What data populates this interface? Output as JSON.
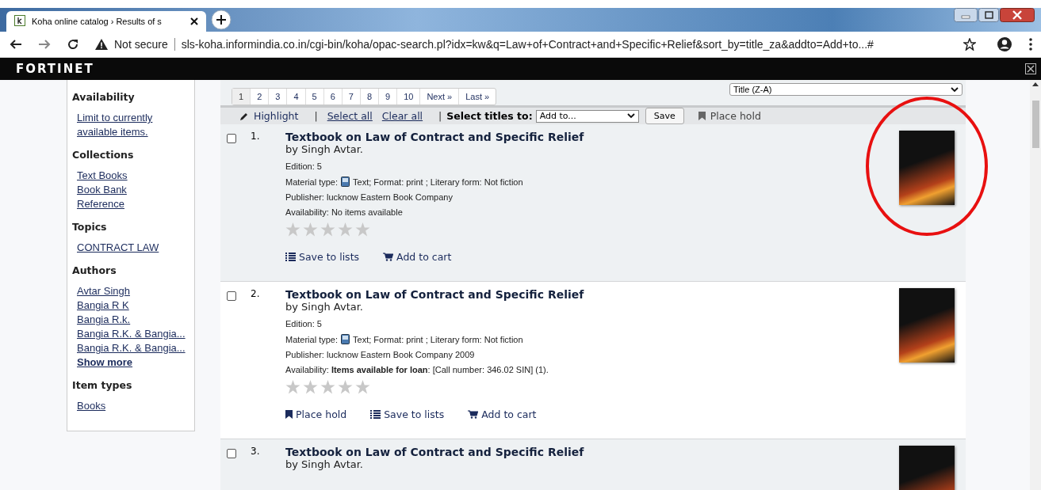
{
  "browser": {
    "tab_title": "Koha online catalog › Results of s",
    "security": "Not secure",
    "url": "sls-koha.informindia.co.in/cgi-bin/koha/opac-search.pl?idx=kw&q=Law+of+Contract+and+Specific+Relief&sort_by=title_za&addto=Add+to...#"
  },
  "banner": {
    "logo": "FORTINET"
  },
  "sidebar": [
    {
      "heading": "Availability",
      "links": [
        {
          "label": "Limit to currently available items.",
          "kind": "link"
        }
      ]
    },
    {
      "heading": "Collections",
      "links": [
        {
          "label": "Text Books",
          "kind": "link"
        },
        {
          "label": "Book Bank",
          "kind": "link"
        },
        {
          "label": "Reference",
          "kind": "link"
        }
      ]
    },
    {
      "heading": "Topics",
      "links": [
        {
          "label": "CONTRACT LAW",
          "kind": "link"
        }
      ]
    },
    {
      "heading": "Authors",
      "links": [
        {
          "label": "Avtar Singh",
          "kind": "link"
        },
        {
          "label": "Bangia R K",
          "kind": "link"
        },
        {
          "label": "Bangia R.k.",
          "kind": "link"
        },
        {
          "label": "Bangia R.K. & Bangia...",
          "kind": "link"
        },
        {
          "label": "Bangia R.K. & Bangia...",
          "kind": "link"
        },
        {
          "label": "Show more",
          "kind": "more"
        }
      ]
    },
    {
      "heading": "Item types",
      "links": [
        {
          "label": "Books",
          "kind": "link"
        }
      ]
    }
  ],
  "pagination": [
    {
      "label": "1",
      "selected": true
    },
    {
      "label": "2",
      "selected": false
    },
    {
      "label": "3",
      "selected": false
    },
    {
      "label": "4",
      "selected": false
    },
    {
      "label": "5",
      "selected": false
    },
    {
      "label": "6",
      "selected": false
    },
    {
      "label": "7",
      "selected": false
    },
    {
      "label": "8",
      "selected": false
    },
    {
      "label": "9",
      "selected": false
    },
    {
      "label": "10",
      "selected": false
    },
    {
      "label": "Next »",
      "selected": false
    },
    {
      "label": "Last »",
      "selected": false
    }
  ],
  "sort": "Title (Z-A)",
  "toolbar": {
    "highlight": "Highlight",
    "separator": "|",
    "select_all": "Select all",
    "clear_all": "Clear all",
    "separator_2": "|",
    "select_titles": "Select titles to:",
    "add_to": "Add to...",
    "save": "Save",
    "place_hold": "Place hold"
  },
  "results": [
    {
      "number": "1.",
      "checked": false,
      "title": "Textbook on Law of Contract and Specific Relief",
      "author": "by Singh Avtar.",
      "edition": "Edition: 5",
      "material_label": "Material type:",
      "material": "Text; Format: print ; Literary form: Not fiction",
      "publisher": "Publisher: lucknow Eastern Book Company",
      "availability": "Availability: No items available",
      "stars": 0,
      "actions": [
        {
          "kind": "lists",
          "label": "Save to lists"
        },
        {
          "kind": "cart",
          "label": "Add to cart"
        }
      ],
      "circled": true
    },
    {
      "number": "2.",
      "checked": false,
      "title": "Textbook on Law of Contract and Specific Relief",
      "author": "by Singh Avtar.",
      "edition": "Edition: 5",
      "material_label": "Material type:",
      "material": "Text; Format: print ; Literary form: Not fiction",
      "publisher": "Publisher: lucknow Eastern Book Company 2009",
      "availability": "Availability: **Items available for loan**: [Call number: 346.02 SIN] (1).",
      "stars": 0,
      "actions": [
        {
          "kind": "hold",
          "label": "Place hold"
        },
        {
          "kind": "lists",
          "label": "Save to lists"
        },
        {
          "kind": "cart",
          "label": "Add to cart"
        }
      ],
      "circled": false
    },
    {
      "number": "3.",
      "checked": false,
      "title": "Textbook on Law of Contract and Specific Relief",
      "author": "by Singh Avtar.",
      "circled": false
    }
  ]
}
